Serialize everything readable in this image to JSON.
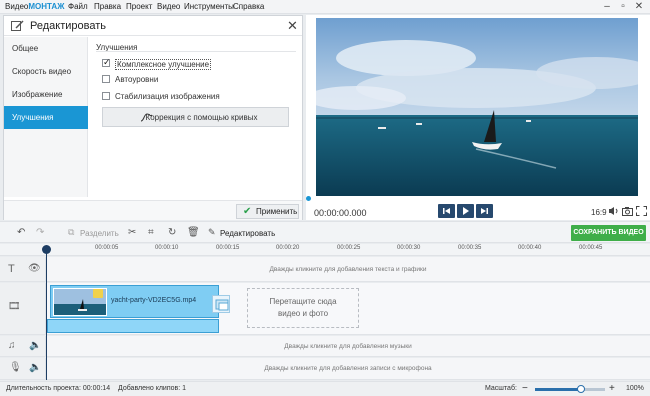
{
  "app": {
    "title_prefix": "Видео",
    "title_brand": "МОНТАЖ"
  },
  "menu": [
    "Файл",
    "Правка",
    "Проект",
    "Видео",
    "Инструменты",
    "Справка"
  ],
  "edit_panel": {
    "title": "Редактировать",
    "tabs": [
      "Общее",
      "Скорость видео",
      "Изображение",
      "Улучшения"
    ],
    "active_tab": "Улучшения",
    "section_title": "Улучшения",
    "options": [
      {
        "label": "Комплексное улучшение",
        "checked": true
      },
      {
        "label": "Автоуровни",
        "checked": false
      },
      {
        "label": "Стабилизация изображения",
        "checked": false
      }
    ],
    "curves_button": "Коррекция с помощью кривых",
    "apply_button": "Применить"
  },
  "preview": {
    "timecode": "00:00:00.000",
    "aspect": "16:9"
  },
  "toolbar": {
    "split": "Разделить",
    "edit": "Редактировать",
    "export": "СОХРАНИТЬ ВИДЕО"
  },
  "ruler": [
    "00:00:05",
    "00:00:10",
    "00:00:15",
    "00:00:20",
    "00:00:25",
    "00:00:30",
    "00:00:35",
    "00:00:40",
    "00:00:45"
  ],
  "tracks": {
    "text_hint": "Дважды кликните для добавления текста и графики",
    "clip_name": "yacht-party-VD2EC5G.mp4",
    "drop_zone_line1": "Перетащите сюда",
    "drop_zone_line2": "видео и фото",
    "music_hint": "Дважды кликните для добавления музыки",
    "mic_hint": "Дважды кликните для добавления записи с микрофона"
  },
  "status": {
    "duration": "Длительность проекта: 00:00:14",
    "clips_added": "Добавлено клипов: 1",
    "zoom_label": "Масштаб:",
    "zoom_value": "100%",
    "zoom_fraction": 0.65
  },
  "colors": {
    "accent": "#1a96d4",
    "export": "#3fae49",
    "controls": "#27496e"
  }
}
